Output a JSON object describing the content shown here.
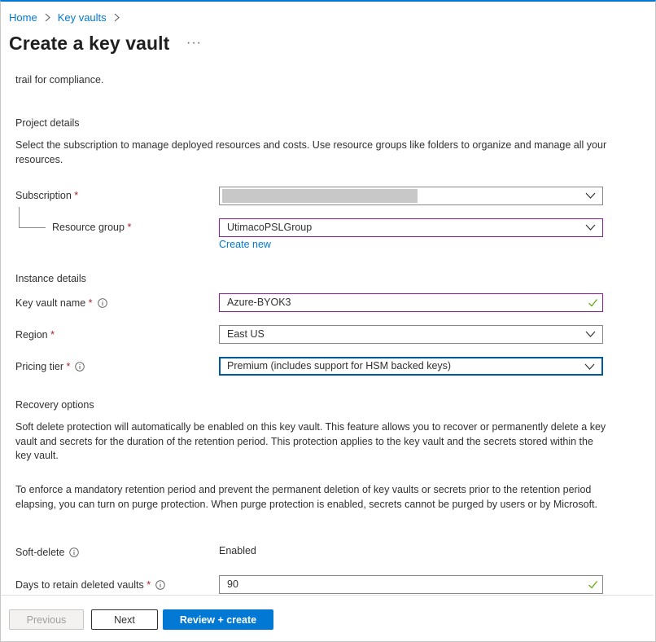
{
  "breadcrumb": {
    "items": [
      "Home",
      "Key vaults"
    ]
  },
  "page": {
    "title": "Create a key vault",
    "more": "···"
  },
  "intro": {
    "trailing_text": "trail for compliance."
  },
  "project": {
    "heading": "Project details",
    "description": "Select the subscription to manage deployed resources and costs. Use resource groups like folders to organize and manage all your resources.",
    "subscription_label": "Subscription",
    "resource_group_label": "Resource group",
    "resource_group_value": "UtimacoPSLGroup",
    "create_new": "Create new"
  },
  "instance": {
    "heading": "Instance details",
    "vault_name_label": "Key vault name",
    "vault_name_value": "Azure-BYOK3",
    "region_label": "Region",
    "region_value": "East US",
    "pricing_label": "Pricing tier",
    "pricing_value": "Premium (includes support for HSM backed keys)"
  },
  "recovery": {
    "heading": "Recovery options",
    "para1": "Soft delete protection will automatically be enabled on this key vault. This feature allows you to recover or permanently delete a key vault and secrets for the duration of the retention period. This protection applies to the key vault and the secrets stored within the key vault.",
    "para2": "To enforce a mandatory retention period and prevent the permanent deletion of key vaults or secrets prior to the retention period elapsing, you can turn on purge protection. When purge protection is enabled, secrets cannot be purged by users or by Microsoft.",
    "soft_delete_label": "Soft-delete",
    "soft_delete_value": "Enabled",
    "days_label": "Days to retain deleted vaults",
    "days_value": "90"
  },
  "required_mark": "*",
  "footer": {
    "previous": "Previous",
    "next": "Next",
    "review": "Review + create"
  },
  "colors": {
    "accent": "#0078d4",
    "required": "#a4262c",
    "valid": "#57a300",
    "invalid_border": "#8a1e9e"
  }
}
